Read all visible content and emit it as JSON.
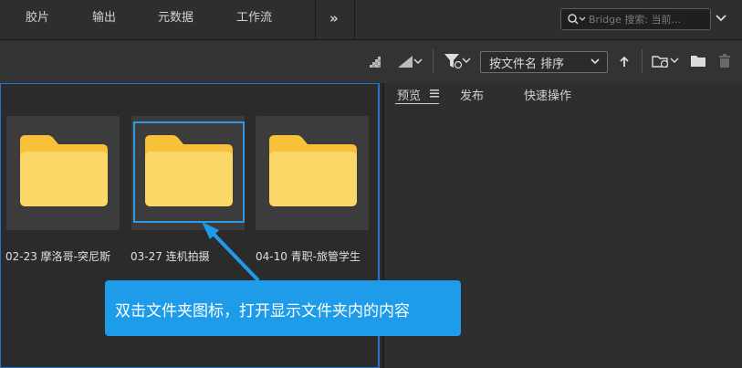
{
  "workspace_tabs": [
    {
      "label": "胶片"
    },
    {
      "label": "输出"
    },
    {
      "label": "元数据"
    },
    {
      "label": "工作流"
    }
  ],
  "more_icon": "»",
  "search": {
    "placeholder": "Bridge 搜索: 当前..."
  },
  "toolbar": {
    "sort_label": "按文件名 排序"
  },
  "right_panel_tabs": [
    {
      "label": "预览"
    },
    {
      "label": "发布"
    },
    {
      "label": "快速操作"
    }
  ],
  "folders": [
    {
      "name": "02-23 摩洛哥-突尼斯"
    },
    {
      "name": "03-27 连机拍摄",
      "selected": true
    },
    {
      "name": "04-10 青职-旅管学生"
    }
  ],
  "callout": {
    "text": "双击文件夹图标，打开显示文件夹内的内容"
  },
  "colors": {
    "accent": "#1e9cea",
    "folder": "#f7c948",
    "selection": "#2f9be6"
  }
}
